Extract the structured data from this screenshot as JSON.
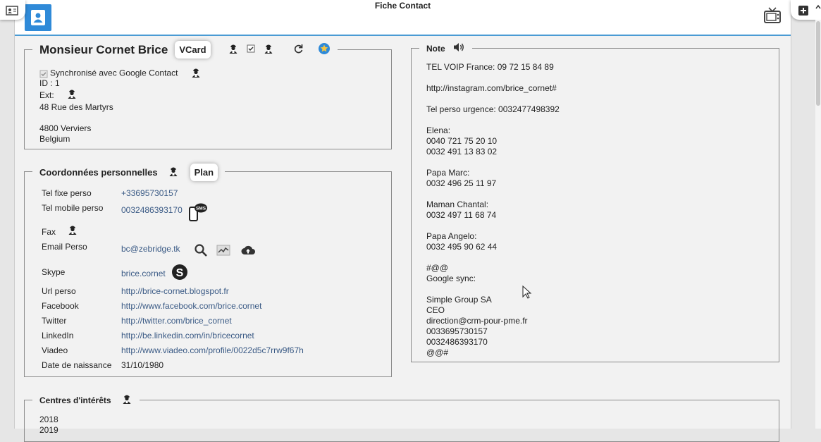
{
  "window": {
    "title": "Fiche Contact"
  },
  "identity": {
    "name": "Monsieur Cornet Brice",
    "vcard_label": "VCard",
    "sync_label": "Synchronisé avec Google Contact",
    "id_line": "ID : 1",
    "ext_label": "Ext:",
    "address_street": "48 Rue des Martyrs",
    "address_city": "4800 Verviers",
    "address_country": "Belgium"
  },
  "coords": {
    "title": "Coordonnées personnelles",
    "plan_label": "Plan",
    "rows": [
      {
        "label": "Tel fixe perso",
        "value": "+33695730157"
      },
      {
        "label": "Tel mobile perso",
        "value": "0032486393170"
      },
      {
        "label": "Fax",
        "value": ""
      },
      {
        "label": "Email Perso",
        "value": "bc@zebridge.tk"
      },
      {
        "label": "Skype",
        "value": "brice.cornet"
      },
      {
        "label": "Url perso",
        "value": "http://brice-cornet.blogspot.fr"
      },
      {
        "label": "Facebook",
        "value": "http://www.facebook.com/brice.cornet"
      },
      {
        "label": "Twitter",
        "value": "http://twitter.com/brice_cornet"
      },
      {
        "label": "LinkedIn",
        "value": "http://be.linkedin.com/in/bricecornet"
      },
      {
        "label": "Viadeo",
        "value": "http://www.viadeo.com/profile/0022d5c7rrw9f67h"
      },
      {
        "label": "Date de naissance",
        "value": "31/10/1980"
      }
    ],
    "sms_badge": "SMS"
  },
  "note": {
    "title": "Note",
    "lines": [
      "TEL VOIP France: 09 72 15 84 89",
      "",
      "http://instagram.com/brice_cornet#",
      "",
      "Tel perso urgence: 0032477498392",
      "",
      "Elena:",
      "0040 721 75 20 10",
      "0032 491 13 83 02",
      "",
      "Papa Marc:",
      "0032 496 25 11 97",
      "",
      "Maman Chantal:",
      "0032 497 11 68 74",
      "",
      "Papa Angelo:",
      "0032 495 90 62 44",
      "",
      "#@@",
      "Google sync:",
      "",
      "Simple Group SA",
      "CEO",
      "direction@crm-pour-pme.fr",
      "0033695730157",
      "0032486393170",
      "@@#"
    ]
  },
  "interests": {
    "title": "Centres d'intérêts",
    "lines": [
      "2018",
      "2019"
    ]
  }
}
